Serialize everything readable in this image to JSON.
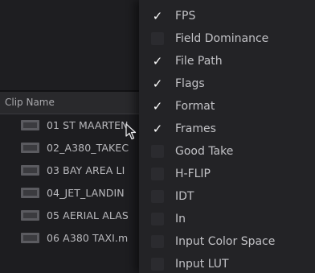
{
  "media_pool": {
    "column_header": "Clip Name",
    "clips": [
      {
        "name": "01 ST MAARTEN",
        "icon": "film-clip-icon"
      },
      {
        "name": "02_A380_TAKEC",
        "icon": "film-clip-icon"
      },
      {
        "name": "03 BAY AREA LI",
        "icon": "film-clip-icon"
      },
      {
        "name": "04_JET_LANDIN",
        "icon": "film-clip-icon"
      },
      {
        "name": "05 AERIAL  ALAS",
        "icon": "film-clip-icon"
      },
      {
        "name": "06 A380 TAXI.m",
        "icon": "film-clip-icon"
      }
    ]
  },
  "column_menu": {
    "check_glyph": "✓",
    "items": [
      {
        "label": "FPS",
        "checked": true
      },
      {
        "label": "Field Dominance",
        "checked": false
      },
      {
        "label": "File Path",
        "checked": true
      },
      {
        "label": "Flags",
        "checked": true
      },
      {
        "label": "Format",
        "checked": true
      },
      {
        "label": "Frames",
        "checked": true
      },
      {
        "label": "Good Take",
        "checked": false
      },
      {
        "label": "H-FLIP",
        "checked": false
      },
      {
        "label": "IDT",
        "checked": false
      },
      {
        "label": "In",
        "checked": false
      },
      {
        "label": "Input Color Space",
        "checked": false
      },
      {
        "label": "Input LUT",
        "checked": false
      }
    ]
  },
  "colors": {
    "menu_background": "#232326",
    "panel_background": "#1d1d20",
    "text": "#c2c2c6",
    "check": "#ffffff"
  }
}
